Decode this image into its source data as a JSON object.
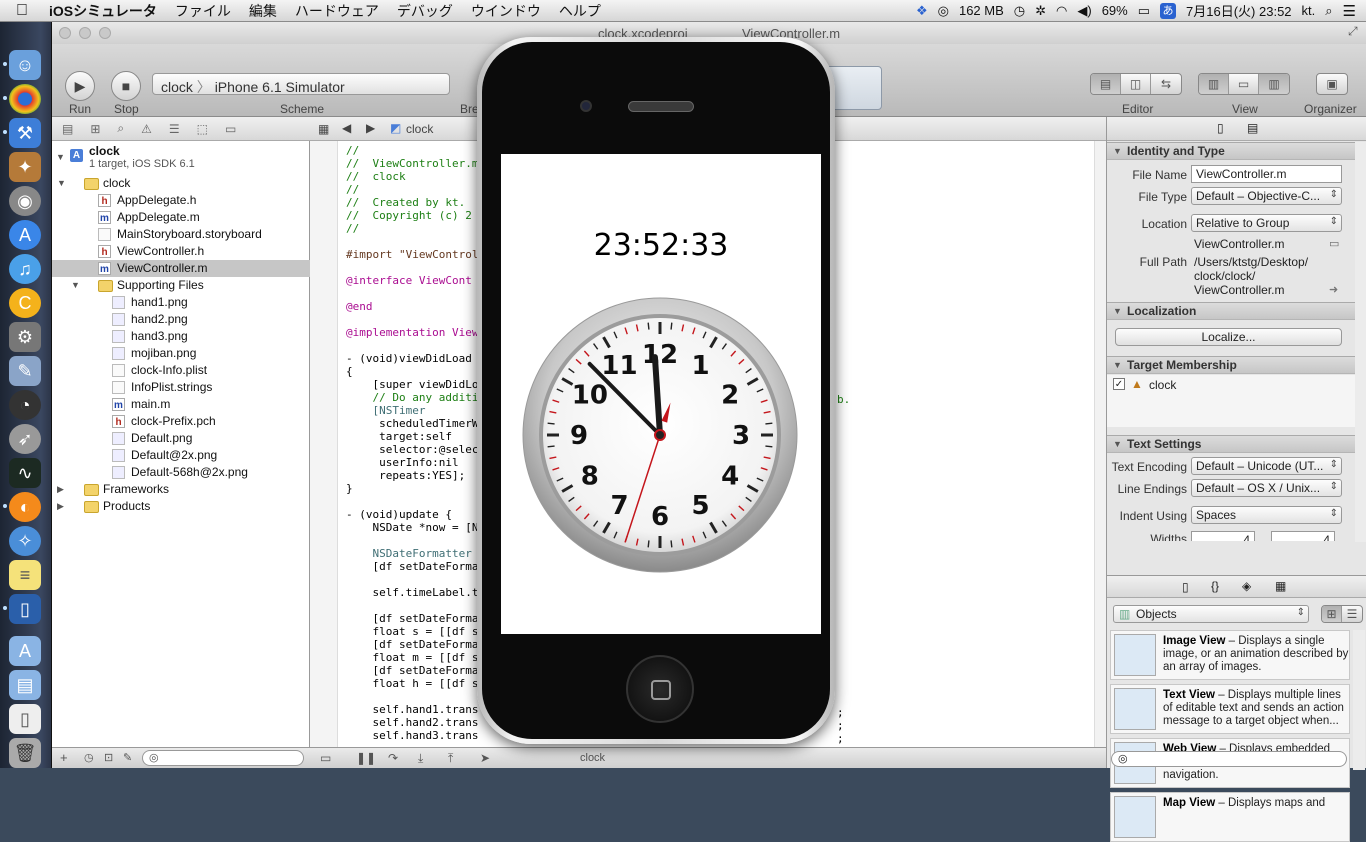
{
  "menubar": {
    "apple": "",
    "items": [
      "iOSシミュレータ",
      "ファイル",
      "編集",
      "ハードウェア",
      "デバッグ",
      "ウインドウ",
      "ヘルプ"
    ],
    "memory": "162 MB",
    "battery": "69%",
    "ime": "あ",
    "datetime": "7月16日(火)  23:52",
    "user": "kt."
  },
  "window": {
    "tab1": "clock.xcodeproj",
    "tab2": "ViewController.m"
  },
  "toolbar": {
    "run": "Run",
    "stop": "Stop",
    "scheme_project": "clock",
    "scheme_target": "iPhone 6.1 Simulator",
    "scheme": "Scheme",
    "breakpoints": "Bre",
    "editor": "Editor",
    "view": "View",
    "organizer": "Organizer"
  },
  "navigator": {
    "project": "clock",
    "project_sub": "1 target, iOS SDK 6.1",
    "items": [
      {
        "label": "clock",
        "type": "folder"
      },
      {
        "label": "AppDelegate.h",
        "type": "h"
      },
      {
        "label": "AppDelegate.m",
        "type": "m"
      },
      {
        "label": "MainStoryboard.storyboard",
        "type": "plain"
      },
      {
        "label": "ViewController.h",
        "type": "h"
      },
      {
        "label": "ViewController.m",
        "type": "m"
      },
      {
        "label": "Supporting Files",
        "type": "folder"
      },
      {
        "label": "hand1.png",
        "type": "img"
      },
      {
        "label": "hand2.png",
        "type": "img"
      },
      {
        "label": "hand3.png",
        "type": "img"
      },
      {
        "label": "mojiban.png",
        "type": "img"
      },
      {
        "label": "clock-Info.plist",
        "type": "plain"
      },
      {
        "label": "InfoPlist.strings",
        "type": "plain"
      },
      {
        "label": "main.m",
        "type": "m"
      },
      {
        "label": "clock-Prefix.pch",
        "type": "h"
      },
      {
        "label": "Default.png",
        "type": "img"
      },
      {
        "label": "Default@2x.png",
        "type": "img"
      },
      {
        "label": "Default-568h@2x.png",
        "type": "img"
      },
      {
        "label": "Frameworks",
        "type": "folder"
      },
      {
        "label": "Products",
        "type": "folder"
      }
    ]
  },
  "jumpbar": {
    "crumb": "clock"
  },
  "editor": {
    "lines": [
      {
        "t": "//",
        "c": "cm"
      },
      {
        "t": "//  ViewController.m",
        "c": "cm"
      },
      {
        "t": "//  clock",
        "c": "cm"
      },
      {
        "t": "//",
        "c": "cm"
      },
      {
        "t": "//  Created by kt.",
        "c": "cm"
      },
      {
        "t": "//  Copyright (c) 2",
        "c": "cm"
      },
      {
        "t": "//",
        "c": "cm"
      },
      {
        "t": "",
        "c": ""
      },
      {
        "t": "#import \"ViewControl",
        "c": "pp"
      },
      {
        "t": "",
        "c": ""
      },
      {
        "t": "@interface ViewCont",
        "c": "kw"
      },
      {
        "t": "",
        "c": ""
      },
      {
        "t": "@end",
        "c": "kw"
      },
      {
        "t": "",
        "c": ""
      },
      {
        "t": "@implementation View",
        "c": "kw"
      },
      {
        "t": "",
        "c": ""
      },
      {
        "t": "- (void)viewDidLoad",
        "c": ""
      },
      {
        "t": "{",
        "c": ""
      },
      {
        "t": "    [super viewDidLo",
        "c": ""
      },
      {
        "t": "    // Do any additi",
        "c": "cm"
      },
      {
        "t": "    [NSTimer",
        "c": "ty"
      },
      {
        "t": "     scheduledTimerW",
        "c": ""
      },
      {
        "t": "     target:self",
        "c": ""
      },
      {
        "t": "     selector:@selec",
        "c": ""
      },
      {
        "t": "     userInfo:nil",
        "c": ""
      },
      {
        "t": "     repeats:YES];",
        "c": ""
      },
      {
        "t": "}",
        "c": ""
      },
      {
        "t": "",
        "c": ""
      },
      {
        "t": "- (void)update {",
        "c": ""
      },
      {
        "t": "    NSDate *now = [N",
        "c": ""
      },
      {
        "t": "",
        "c": ""
      },
      {
        "t": "    NSDateFormatter ",
        "c": "ty"
      },
      {
        "t": "    [df setDateForma",
        "c": ""
      },
      {
        "t": "",
        "c": ""
      },
      {
        "t": "    self.timeLabel.t",
        "c": ""
      },
      {
        "t": "",
        "c": ""
      },
      {
        "t": "    [df setDateForma",
        "c": ""
      },
      {
        "t": "    float s = [[df s",
        "c": ""
      },
      {
        "t": "    [df setDateForma",
        "c": ""
      },
      {
        "t": "    float m = [[df s",
        "c": ""
      },
      {
        "t": "    [df setDateForma",
        "c": ""
      },
      {
        "t": "    float h = [[df s",
        "c": ""
      },
      {
        "t": "",
        "c": ""
      },
      {
        "t": "    self.hand1.trans",
        "c": ""
      },
      {
        "t": "    self.hand2.trans",
        "c": ""
      },
      {
        "t": "    self.hand3.trans",
        "c": ""
      },
      {
        "t": "",
        "c": ""
      },
      {
        "t": "}",
        "c": ""
      }
    ],
    "overflow_b": "b.",
    "overflow_semis": [
      ";",
      ";",
      ";"
    ]
  },
  "debugbar": {
    "target": "clock"
  },
  "inspector": {
    "identity_title": "Identity and Type",
    "file_name_label": "File Name",
    "file_name": "ViewController.m",
    "file_type_label": "File Type",
    "file_type": "Default – Objective-C...",
    "location_label": "Location",
    "location": "Relative to Group",
    "location_file": "ViewController.m",
    "full_path_label": "Full Path",
    "full_path": [
      "/Users/ktstg/Desktop/",
      "clock/clock/",
      "ViewController.m"
    ],
    "localization_title": "Localization",
    "localize_button": "Localize...",
    "target_membership_title": "Target Membership",
    "target": "clock",
    "text_settings_title": "Text Settings",
    "text_encoding_label": "Text Encoding",
    "text_encoding": "Default – Unicode (UT...",
    "line_endings_label": "Line Endings",
    "line_endings": "Default – OS X / Unix...",
    "indent_using_label": "Indent Using",
    "indent_using": "Spaces",
    "widths_label": "Widths",
    "width_tab": "4",
    "width_indent": "4"
  },
  "library": {
    "popup": "Objects",
    "items": [
      {
        "title": "Image View",
        "desc": " – Displays a single image, or an animation described by an array of images."
      },
      {
        "title": "Text View",
        "desc": " – Displays multiple lines of editable text and sends an action message to a target object when..."
      },
      {
        "title": "Web View",
        "desc": " – Displays embedded web content and enables content navigation."
      },
      {
        "title": "Map View",
        "desc": " – Displays maps and"
      }
    ]
  },
  "simulator": {
    "time": "23:52:33",
    "hour": 23,
    "minute": 52,
    "second": 33,
    "numerals": [
      "12",
      "1",
      "2",
      "3",
      "4",
      "5",
      "6",
      "7",
      "8",
      "9",
      "10",
      "11"
    ]
  },
  "colors": {
    "second_hand": "#c4161c",
    "selection": "#c6c6c6"
  }
}
